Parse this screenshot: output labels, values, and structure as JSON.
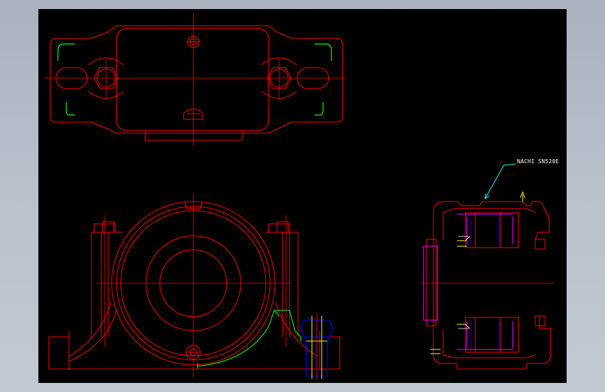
{
  "annotation": {
    "callout_label": "NACHI SN520E"
  },
  "colors": {
    "background_frame": "#b4bcc6",
    "canvas": "#000000",
    "outline": "#ff0000",
    "accent_green": "#00ff00",
    "accent_blue": "#0000ff",
    "accent_yellow": "#ffff00",
    "accent_magenta": "#ff00ff",
    "leader_cyan": "#00ffff",
    "text": "#ffffff"
  },
  "views": [
    "top-view",
    "front-view",
    "side-section-view"
  ]
}
